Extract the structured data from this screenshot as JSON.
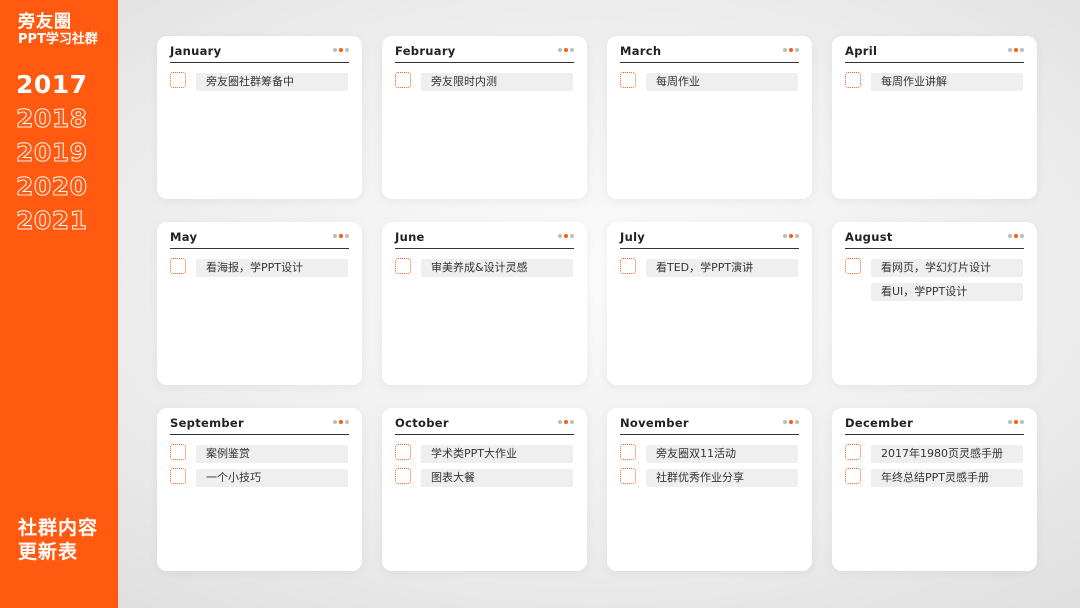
{
  "sidebar": {
    "brand_name": "旁友圈",
    "brand_sub": "PPT学习社群",
    "years": [
      "2017",
      "2018",
      "2019",
      "2020",
      "2021"
    ],
    "active_year": "2017",
    "title_line1": "社群内容",
    "title_line2": "更新表"
  },
  "colors": {
    "accent": "#ff5a0f",
    "card": "#ffffff",
    "task_bg": "#efefef"
  },
  "months": [
    {
      "name": "January",
      "tasks": [
        {
          "label": "旁友圈社群筹备中",
          "checkbox": true
        }
      ]
    },
    {
      "name": "February",
      "tasks": [
        {
          "label": "旁友限时内测",
          "checkbox": true
        }
      ]
    },
    {
      "name": "March",
      "tasks": [
        {
          "label": "每周作业",
          "checkbox": true
        }
      ]
    },
    {
      "name": "April",
      "tasks": [
        {
          "label": "每周作业讲解",
          "checkbox": true
        }
      ]
    },
    {
      "name": "May",
      "tasks": [
        {
          "label": "看海报，学PPT设计",
          "checkbox": true
        }
      ]
    },
    {
      "name": "June",
      "tasks": [
        {
          "label": "审美养成&设计灵感",
          "checkbox": true
        }
      ]
    },
    {
      "name": "July",
      "tasks": [
        {
          "label": "看TED，学PPT演讲",
          "checkbox": true
        }
      ]
    },
    {
      "name": "August",
      "tasks": [
        {
          "label": "看网页，学幻灯片设计",
          "checkbox": true
        },
        {
          "label": "看UI，学PPT设计",
          "checkbox": false
        }
      ]
    },
    {
      "name": "September",
      "tasks": [
        {
          "label": "案例鉴赏",
          "checkbox": true
        },
        {
          "label": "一个小技巧",
          "checkbox": true
        }
      ]
    },
    {
      "name": "October",
      "tasks": [
        {
          "label": "学术类PPT大作业",
          "checkbox": true
        },
        {
          "label": "图表大餐",
          "checkbox": true
        }
      ]
    },
    {
      "name": "November",
      "tasks": [
        {
          "label": "旁友圈双11活动",
          "checkbox": true
        },
        {
          "label": "社群优秀作业分享",
          "checkbox": true
        }
      ]
    },
    {
      "name": "December",
      "tasks": [
        {
          "label": "2017年1980页灵感手册",
          "checkbox": true
        },
        {
          "label": "年终总结PPT灵感手册",
          "checkbox": true
        }
      ]
    }
  ]
}
